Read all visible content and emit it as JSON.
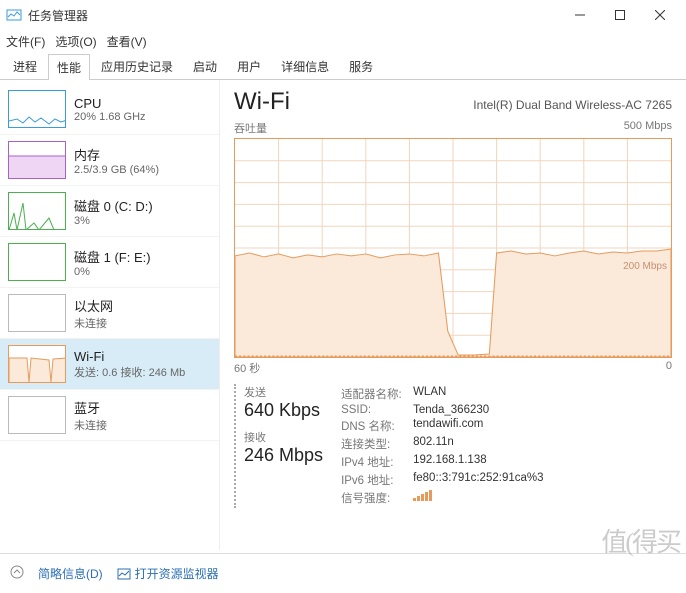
{
  "window": {
    "title": "任务管理器"
  },
  "menu": {
    "file": "文件(F)",
    "options": "选项(O)",
    "view": "查看(V)"
  },
  "tabs": [
    "进程",
    "性能",
    "应用历史记录",
    "启动",
    "用户",
    "详细信息",
    "服务"
  ],
  "active_tab": 1,
  "sidebar": [
    {
      "name": "CPU",
      "sub": "20% 1.68 GHz",
      "color": "#3a9bdc"
    },
    {
      "name": "内存",
      "sub": "2.5/3.9 GB (64%)",
      "color": "#a861c7"
    },
    {
      "name": "磁盘 0 (C: D:)",
      "sub": "3%",
      "color": "#4caf50"
    },
    {
      "name": "磁盘 1 (F: E:)",
      "sub": "0%",
      "color": "#4caf50"
    },
    {
      "name": "以太网",
      "sub": "未连接",
      "color": "#bbbbbb"
    },
    {
      "name": "Wi-Fi",
      "sub": "发送: 0.6 接收: 246 Mb",
      "color": "#e69b5b",
      "selected": true
    },
    {
      "name": "蓝牙",
      "sub": "未连接",
      "color": "#bbbbbb"
    }
  ],
  "main": {
    "title": "Wi-Fi",
    "adapter": "Intel(R) Dual Band Wireless-AC 7265",
    "ylabel": "吞吐量",
    "ymax": "500 Mbps",
    "ref_line": "200 Mbps",
    "xleft": "60 秒",
    "xright": "0",
    "send_label": "发送",
    "send_value": "640 Kbps",
    "recv_label": "接收",
    "recv_value": "246 Mbps",
    "details": {
      "adapter_name_k": "适配器名称:",
      "adapter_name_v": "WLAN",
      "ssid_k": "SSID:",
      "ssid_v": "Tenda_366230",
      "dns_k": "DNS 名称:",
      "dns_v": "tendawifi.com",
      "conn_k": "连接类型:",
      "conn_v": "802.11n",
      "ipv4_k": "IPv4 地址:",
      "ipv4_v": "192.168.1.138",
      "ipv6_k": "IPv6 地址:",
      "ipv6_v": "fe80::3:791c:252:91ca%3",
      "signal_k": "信号强度:"
    }
  },
  "footer": {
    "less": "简略信息(D)",
    "resmon": "打开资源监视器"
  },
  "watermark": "值(得买",
  "chart_data": {
    "type": "line",
    "title": "Wi-Fi 吞吐量",
    "xlabel": "60 秒 → 0",
    "ylabel": "吞吐量",
    "ylim": [
      0,
      500
    ],
    "unit": "Mbps",
    "x_seconds_ago": [
      60,
      58,
      56,
      54,
      52,
      50,
      48,
      46,
      44,
      42,
      40,
      38,
      36,
      34,
      32,
      30,
      28,
      26,
      24,
      22,
      20,
      18,
      16,
      14,
      12,
      10,
      8,
      6,
      4,
      2,
      0
    ],
    "series": [
      {
        "name": "接收",
        "values": [
          232,
          238,
          230,
          236,
          228,
          234,
          230,
          236,
          232,
          235,
          228,
          233,
          236,
          232,
          238,
          60,
          3,
          3,
          5,
          238,
          241,
          235,
          237,
          232,
          238,
          242,
          236,
          241,
          237,
          240,
          246
        ]
      },
      {
        "name": "发送",
        "values": [
          0.6,
          0.6,
          0.6,
          0.6,
          0.6,
          0.6,
          0.6,
          0.6,
          0.6,
          0.6,
          0.6,
          0.6,
          0.6,
          0.6,
          0.6,
          0.6,
          0.6,
          0.6,
          0.6,
          0.6,
          0.6,
          0.6,
          0.6,
          0.6,
          0.6,
          0.6,
          0.6,
          0.6,
          0.6,
          0.6,
          0.6
        ]
      }
    ],
    "annotations": [
      "200 Mbps"
    ]
  }
}
